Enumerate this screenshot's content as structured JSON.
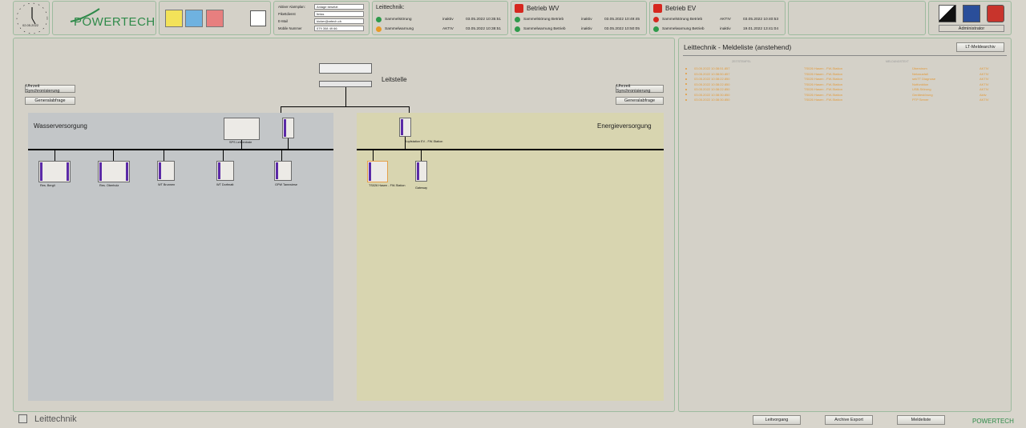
{
  "header": {
    "clock_date": "02.05.2022",
    "logo_text": "POWERTECH",
    "user": {
      "labels": [
        "Aktiver Alarmplan:",
        "Pikettdienst",
        "E-Mail",
        "Mobile Nummer"
      ],
      "values": [
        "Anlage besetzt",
        "fmiss",
        "kicker@artech.ch",
        "079 308 49 66"
      ]
    },
    "leittechnik": {
      "title": "Leittechnik:",
      "rows": [
        {
          "name": "Sammelstörung",
          "status": "inaktiv",
          "time": "03.05.2022 10:35:51",
          "color": "#2e9a4b"
        },
        {
          "name": "Sammelwarnung",
          "status": "AKTIV",
          "time": "03.05.2022 10:38:51",
          "color": "#e79a27"
        }
      ]
    },
    "betrieb_wv": {
      "title": "Betrieb WV",
      "rows": [
        {
          "name": "Sammelstörung Betrieb",
          "status": "inaktiv",
          "time": "03.05.2022 10:49:45",
          "color": "#2e9a4b"
        },
        {
          "name": "Sammelwarnung Betrieb",
          "status": "inaktiv",
          "time": "03.05.2022 10:50:05",
          "color": "#2e9a4b"
        }
      ]
    },
    "betrieb_ev": {
      "title": "Betrieb EV",
      "rows": [
        {
          "name": "Sammelstörung Betrieb",
          "status": "AKTIV",
          "time": "03.05.2022 10:40:53",
          "color": "#d6271f"
        },
        {
          "name": "Sammelwarnung Betrieb",
          "status": "inaktiv",
          "time": "19.01.2022 13:41:04",
          "color": "#2e9a4b"
        }
      ]
    },
    "admin_label": "Administrator"
  },
  "main": {
    "leitstelle_label": "Leitstelle",
    "left_buttons": [
      "Uhrzeit Synchronisierung",
      "Generalabfrage"
    ],
    "right_buttons": [
      "Uhrzeit Synchronisierung",
      "Generalabfrage"
    ],
    "wasser": {
      "title": "Wasserversorgung",
      "top_devices": [
        "SPS Leitzentrale",
        "Kommunikation"
      ],
      "devices": [
        "Res. Bergli",
        "Res. Oberholz",
        "WT Brunnen",
        "WT Dorfmatt",
        "GPW Tannwiese"
      ]
    },
    "energie": {
      "title": "Energieversorgung",
      "top_device": "Kopfstation EV - FW-Station",
      "devices": [
        "TS026 Hasen - FW-Station",
        "Gateway"
      ]
    }
  },
  "alarms": {
    "title": "Leittechnik - Meldeliste (anstehend)",
    "archive_button": "LT-Meldearchiv",
    "col_headers": [
      "ZEITSTEMPEL",
      "MELDUNGSTEXT"
    ],
    "rows": [
      {
        "time": "03.05.2022 10:38:51.857",
        "src": "TS026 Hasen - FW-Station",
        "text": "Überstrom",
        "state": "AKTIV"
      },
      {
        "time": "03.05.2022 10:38:50.857",
        "src": "TS026 Hasen - FW-Station",
        "text": "Netzausfall",
        "state": "AKTIV"
      },
      {
        "time": "03.05.2022 10:38:22.850",
        "src": "TS026 Hasen - FW-Station",
        "text": "sekTT Diagnose",
        "state": "AKTIV"
      },
      {
        "time": "03.05.2022 10:38:22.850",
        "src": "TS026 Hasen - FW-Station",
        "text": "Notfunktion",
        "state": "AKTIV"
      },
      {
        "time": "03.05.2022 10:38:22.850",
        "src": "TS026 Hasen - FW-Station",
        "text": "USB-Störung",
        "state": "AKTIV"
      },
      {
        "time": "03.05.2022 10:38:30.850",
        "src": "TS026 Hasen - FW-Station",
        "text": "Gerätestörung",
        "state": "Aktiv"
      },
      {
        "time": "03.05.2022 10:38:30.850",
        "src": "TS026 Hasen - FW-Station",
        "text": "PTP Server",
        "state": "AKTIV"
      }
    ]
  },
  "footer": {
    "title": "Leittechnik",
    "buttons": [
      "Leitvorgang",
      "Archive Export",
      "Meldeliste"
    ],
    "logo_text": "POWERTECH"
  }
}
